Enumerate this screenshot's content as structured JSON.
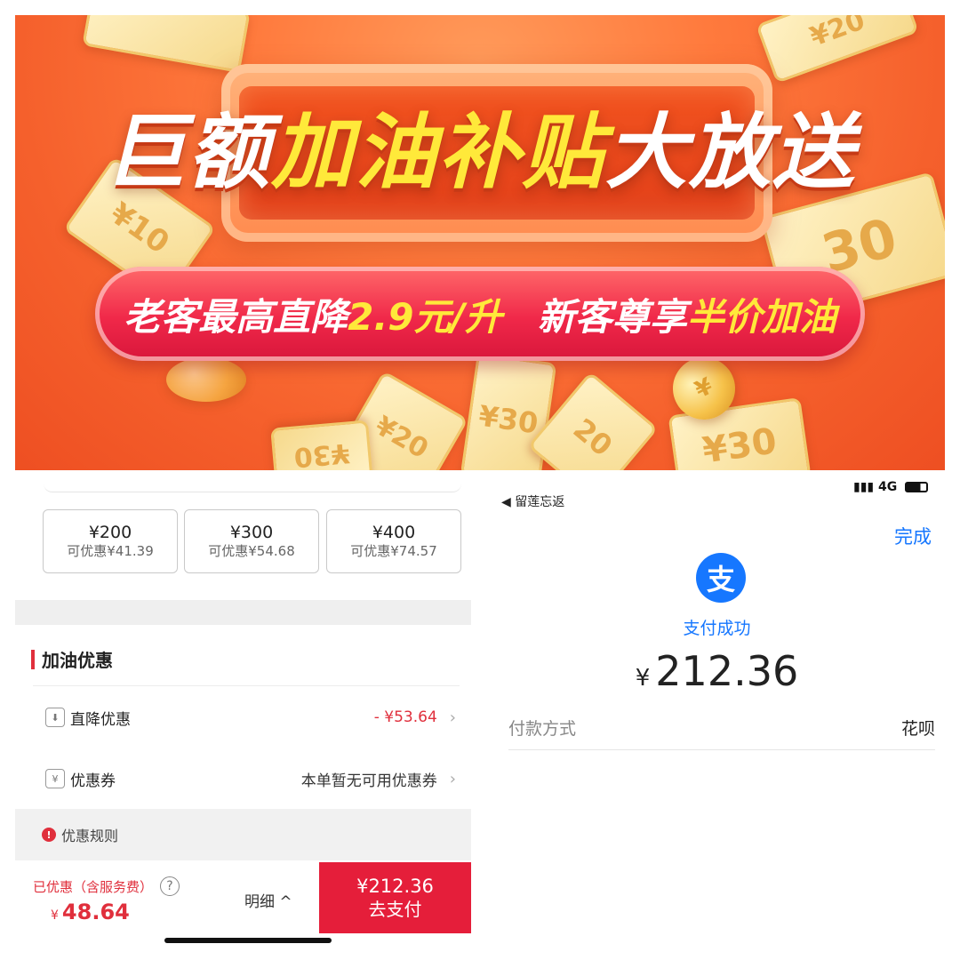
{
  "banner": {
    "headline_white_1": "巨额",
    "headline_yellow": "加油补贴",
    "headline_white_2": "大放送",
    "pill_white_1": "老客最高直降",
    "pill_yellow_1": "2.9元/升",
    "pill_white_2": "新客尊享",
    "pill_yellow_2": "半价加油",
    "tickets": [
      "¥10",
      "¥20",
      "30",
      "¥30",
      "¥20",
      "¥30",
      "¥30",
      "20"
    ]
  },
  "left_screen": {
    "amount_options": [
      {
        "amount": "¥200",
        "discount": "可优惠¥41.39"
      },
      {
        "amount": "¥300",
        "discount": "可优惠¥54.68"
      },
      {
        "amount": "¥400",
        "discount": "可优惠¥74.57"
      }
    ],
    "section_title": "加油优惠",
    "rows": {
      "direct": {
        "label": "直降优惠",
        "value": "- ¥53.64"
      },
      "coupon": {
        "label": "优惠券",
        "value": "本单暂无可用优惠券"
      }
    },
    "rules_label": "优惠规则",
    "bottom": {
      "saved_label": "已优惠（含服务费）",
      "saved_currency": "¥",
      "saved_amount": "48.64",
      "detail_label": "明细",
      "pay_amount": "¥212.36",
      "pay_label": "去支付"
    }
  },
  "right_screen": {
    "back_label": "留莲忘返",
    "status_network": "4G",
    "done_label": "完成",
    "logo_char": "支",
    "success_text": "支付成功",
    "currency": "¥",
    "amount": "212.36",
    "method_label": "付款方式",
    "method_value": "花呗"
  },
  "colors": {
    "banner_orange": "#f5602c",
    "headline_yellow": "#ffe93a",
    "accent_red": "#e51e3a",
    "alipay_blue": "#1677ff"
  }
}
